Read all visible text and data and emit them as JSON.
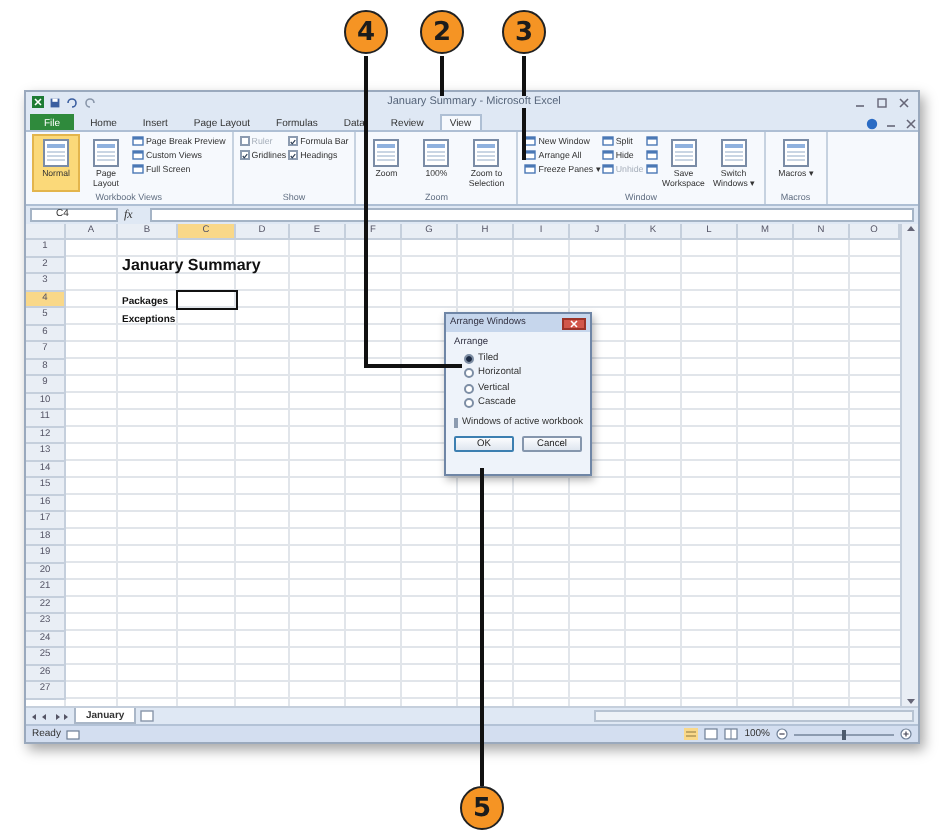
{
  "callouts": [
    {
      "number": "4"
    },
    {
      "number": "2"
    },
    {
      "number": "3"
    },
    {
      "number": "5"
    }
  ],
  "window": {
    "title": "January Summary - Microsoft Excel"
  },
  "ribbon_tabs": [
    {
      "label": "File",
      "kind": "file",
      "selected": false
    },
    {
      "label": "Home",
      "kind": "tab",
      "selected": false
    },
    {
      "label": "Insert",
      "kind": "tab",
      "selected": false
    },
    {
      "label": "Page Layout",
      "kind": "tab",
      "selected": false
    },
    {
      "label": "Formulas",
      "kind": "tab",
      "selected": false
    },
    {
      "label": "Data",
      "kind": "tab",
      "selected": false
    },
    {
      "label": "Review",
      "kind": "tab",
      "selected": false
    },
    {
      "label": "View",
      "kind": "tab",
      "selected": true
    }
  ],
  "ribbon_groups": [
    {
      "label": "Workbook Views",
      "items": [
        {
          "kind": "large",
          "label": "Normal",
          "selected": true
        },
        {
          "kind": "large",
          "label": "Page Layout",
          "selected": false
        },
        {
          "kind": "stack",
          "items": [
            {
              "kind": "small",
              "label": "Page Break Preview"
            },
            {
              "kind": "small",
              "label": "Custom Views"
            },
            {
              "kind": "small",
              "label": "Full Screen"
            }
          ]
        }
      ]
    },
    {
      "label": "Show",
      "items": [
        {
          "kind": "stack",
          "items": [
            {
              "kind": "check",
              "label": "Ruler",
              "checked": false,
              "disabled": true
            },
            {
              "kind": "check",
              "label": "Gridlines",
              "checked": true,
              "disabled": false
            }
          ]
        },
        {
          "kind": "stack",
          "items": [
            {
              "kind": "check",
              "label": "Formula Bar",
              "checked": true,
              "disabled": false
            },
            {
              "kind": "check",
              "label": "Headings",
              "checked": true,
              "disabled": false
            }
          ]
        }
      ]
    },
    {
      "label": "Zoom",
      "items": [
        {
          "kind": "large",
          "label": "Zoom",
          "selected": false
        },
        {
          "kind": "large",
          "label": "100%",
          "selected": false
        },
        {
          "kind": "large",
          "label": "Zoom to Selection",
          "selected": false
        }
      ]
    },
    {
      "label": "Window",
      "items": [
        {
          "kind": "stack",
          "items": [
            {
              "kind": "small",
              "label": "New Window"
            },
            {
              "kind": "small",
              "label": "Arrange All"
            },
            {
              "kind": "small",
              "label": "Freeze Panes ▾"
            }
          ]
        },
        {
          "kind": "stack",
          "items": [
            {
              "kind": "small",
              "label": "Split"
            },
            {
              "kind": "small",
              "label": "Hide"
            },
            {
              "kind": "small",
              "label": "Unhide",
              "disabled": true
            }
          ]
        },
        {
          "kind": "icons"
        },
        {
          "kind": "large",
          "label": "Save Workspace",
          "selected": false
        },
        {
          "kind": "large",
          "label": "Switch Windows ▾",
          "selected": false
        }
      ]
    },
    {
      "label": "Macros",
      "items": [
        {
          "kind": "large",
          "label": "Macros ▾",
          "selected": false
        }
      ]
    }
  ],
  "formula_bar": {
    "name_box": "C4",
    "function_label": "fx"
  },
  "columns": [
    {
      "label": "A",
      "selected": false
    },
    {
      "label": "B",
      "selected": false
    },
    {
      "label": "C",
      "selected": true
    },
    {
      "label": "D",
      "selected": false
    },
    {
      "label": "E",
      "selected": false
    },
    {
      "label": "F",
      "selected": false
    },
    {
      "label": "G",
      "selected": false
    },
    {
      "label": "H",
      "selected": false
    },
    {
      "label": "I",
      "selected": false
    },
    {
      "label": "J",
      "selected": false
    },
    {
      "label": "K",
      "selected": false
    },
    {
      "label": "L",
      "selected": false
    },
    {
      "label": "M",
      "selected": false
    },
    {
      "label": "N",
      "selected": false
    },
    {
      "label": "O",
      "selected": false
    }
  ],
  "rows": [
    {
      "number": "1",
      "selected": false
    },
    {
      "number": "2",
      "selected": false,
      "cell_b": {
        "kind": "title",
        "text": "January Summary"
      }
    },
    {
      "number": "3",
      "selected": false
    },
    {
      "number": "4",
      "selected": true,
      "cell_b": {
        "kind": "label",
        "text": "Packages"
      }
    },
    {
      "number": "5",
      "selected": false,
      "cell_b": {
        "kind": "label",
        "text": "Exceptions"
      }
    },
    {
      "number": "6",
      "selected": false
    },
    {
      "number": "7",
      "selected": false
    },
    {
      "number": "8",
      "selected": false
    },
    {
      "number": "9",
      "selected": false
    },
    {
      "number": "10",
      "selected": false
    },
    {
      "number": "11",
      "selected": false
    },
    {
      "number": "12",
      "selected": false
    },
    {
      "number": "13",
      "selected": false
    },
    {
      "number": "14",
      "selected": false
    },
    {
      "number": "15",
      "selected": false
    },
    {
      "number": "16",
      "selected": false
    },
    {
      "number": "17",
      "selected": false
    },
    {
      "number": "18",
      "selected": false
    },
    {
      "number": "19",
      "selected": false
    },
    {
      "number": "20",
      "selected": false
    },
    {
      "number": "21",
      "selected": false
    },
    {
      "number": "22",
      "selected": false
    },
    {
      "number": "23",
      "selected": false
    },
    {
      "number": "24",
      "selected": false
    },
    {
      "number": "25",
      "selected": false
    },
    {
      "number": "26",
      "selected": false
    },
    {
      "number": "27",
      "selected": false
    }
  ],
  "sheet_tabs": [
    {
      "label": "January",
      "selected": true
    }
  ],
  "status_bar": {
    "text": "Ready",
    "zoom": "100%",
    "zoom_slider": {
      "level": 0.5
    }
  },
  "dialog": {
    "title": "Arrange Windows",
    "group_label": "Arrange",
    "options": [
      {
        "label": "Tiled",
        "selected": true
      },
      {
        "label": "Horizontal",
        "selected": false
      },
      {
        "label": "Vertical",
        "selected": false
      },
      {
        "label": "Cascade",
        "selected": false
      }
    ],
    "checkbox": {
      "label": "Windows of active workbook",
      "checked": false
    },
    "buttons": [
      "OK",
      "Cancel"
    ]
  }
}
